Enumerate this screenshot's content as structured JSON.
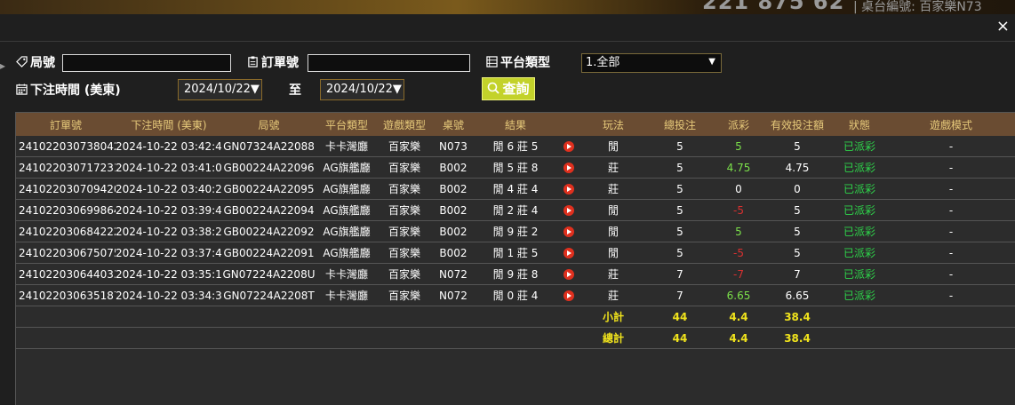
{
  "background": {
    "big_text": "221 875 62",
    "side_text": "| 桌台編號: 百家樂N73"
  },
  "modal": {
    "close_glyph": "×"
  },
  "filters": {
    "round_label": "局號",
    "round_value": "",
    "order_label": "訂單號",
    "order_value": "",
    "platform_label": "平台類型",
    "platform_selected": "1.全部",
    "time_label": "下注時間 (美東)",
    "date_from": "2024/10/22▼",
    "to_label": "至",
    "date_to": "2024/10/22▼",
    "query_label": "查詢"
  },
  "table": {
    "headers": [
      "訂單號",
      "下注時間 (美東)",
      "局號",
      "平台類型",
      "遊戲類型",
      "桌號",
      "結果",
      "",
      "玩法",
      "總投注",
      "派彩",
      "有效投注額",
      "狀態",
      "遊戲模式"
    ],
    "rows": [
      {
        "order": "241022030738042",
        "time": "2024-10-22 03:42:46",
        "round": "GN07324A22088",
        "platform": "卡卡灣廳",
        "game": "百家樂",
        "table": "N073",
        "result": "閒 6 莊 5",
        "play": "閒",
        "bet": "5",
        "payout": "5",
        "payout_color": "green",
        "valid": "5",
        "status": "已派彩",
        "mode": "-"
      },
      {
        "order": "241022030717231",
        "time": "2024-10-22 03:41:08",
        "round": "GB00224A22096",
        "platform": "AG旗艦廳",
        "game": "百家樂",
        "table": "B002",
        "result": "閒 5 莊 8",
        "play": "莊",
        "bet": "5",
        "payout": "4.75",
        "payout_color": "green",
        "valid": "4.75",
        "status": "已派彩",
        "mode": "-"
      },
      {
        "order": "241022030709420",
        "time": "2024-10-22 03:40:27",
        "round": "GB00224A22095",
        "platform": "AG旗艦廳",
        "game": "百家樂",
        "table": "B002",
        "result": "閒 4 莊 4",
        "play": "莊",
        "bet": "5",
        "payout": "0",
        "payout_color": "white",
        "valid": "0",
        "status": "已派彩",
        "mode": "-"
      },
      {
        "order": "241022030699864",
        "time": "2024-10-22 03:39:43",
        "round": "GB00224A22094",
        "platform": "AG旗艦廳",
        "game": "百家樂",
        "table": "B002",
        "result": "閒 2 莊 4",
        "play": "閒",
        "bet": "5",
        "payout": "-5",
        "payout_color": "red",
        "valid": "5",
        "status": "已派彩",
        "mode": "-"
      },
      {
        "order": "241022030684222",
        "time": "2024-10-22 03:38:26",
        "round": "GB00224A22092",
        "platform": "AG旗艦廳",
        "game": "百家樂",
        "table": "B002",
        "result": "閒 9 莊 2",
        "play": "閒",
        "bet": "5",
        "payout": "5",
        "payout_color": "green",
        "valid": "5",
        "status": "已派彩",
        "mode": "-"
      },
      {
        "order": "241022030675075",
        "time": "2024-10-22 03:37:44",
        "round": "GB00224A22091",
        "platform": "AG旗艦廳",
        "game": "百家樂",
        "table": "B002",
        "result": "閒 1 莊 5",
        "play": "閒",
        "bet": "5",
        "payout": "-5",
        "payout_color": "red",
        "valid": "5",
        "status": "已派彩",
        "mode": "-"
      },
      {
        "order": "241022030644033",
        "time": "2024-10-22 03:35:14",
        "round": "GN07224A2208U",
        "platform": "卡卡灣廳",
        "game": "百家樂",
        "table": "N072",
        "result": "閒 9 莊 8",
        "play": "莊",
        "bet": "7",
        "payout": "-7",
        "payout_color": "red",
        "valid": "7",
        "status": "已派彩",
        "mode": "-"
      },
      {
        "order": "241022030635187",
        "time": "2024-10-22 03:34:30",
        "round": "GN07224A2208T",
        "platform": "卡卡灣廳",
        "game": "百家樂",
        "table": "N072",
        "result": "閒 0 莊 4",
        "play": "莊",
        "bet": "7",
        "payout": "6.65",
        "payout_color": "green",
        "valid": "6.65",
        "status": "已派彩",
        "mode": "-"
      }
    ],
    "subtotal": {
      "label": "小計",
      "bet": "44",
      "payout": "4.4",
      "valid": "38.4"
    },
    "total": {
      "label": "總計",
      "bet": "44",
      "payout": "4.4",
      "valid": "38.4"
    }
  }
}
